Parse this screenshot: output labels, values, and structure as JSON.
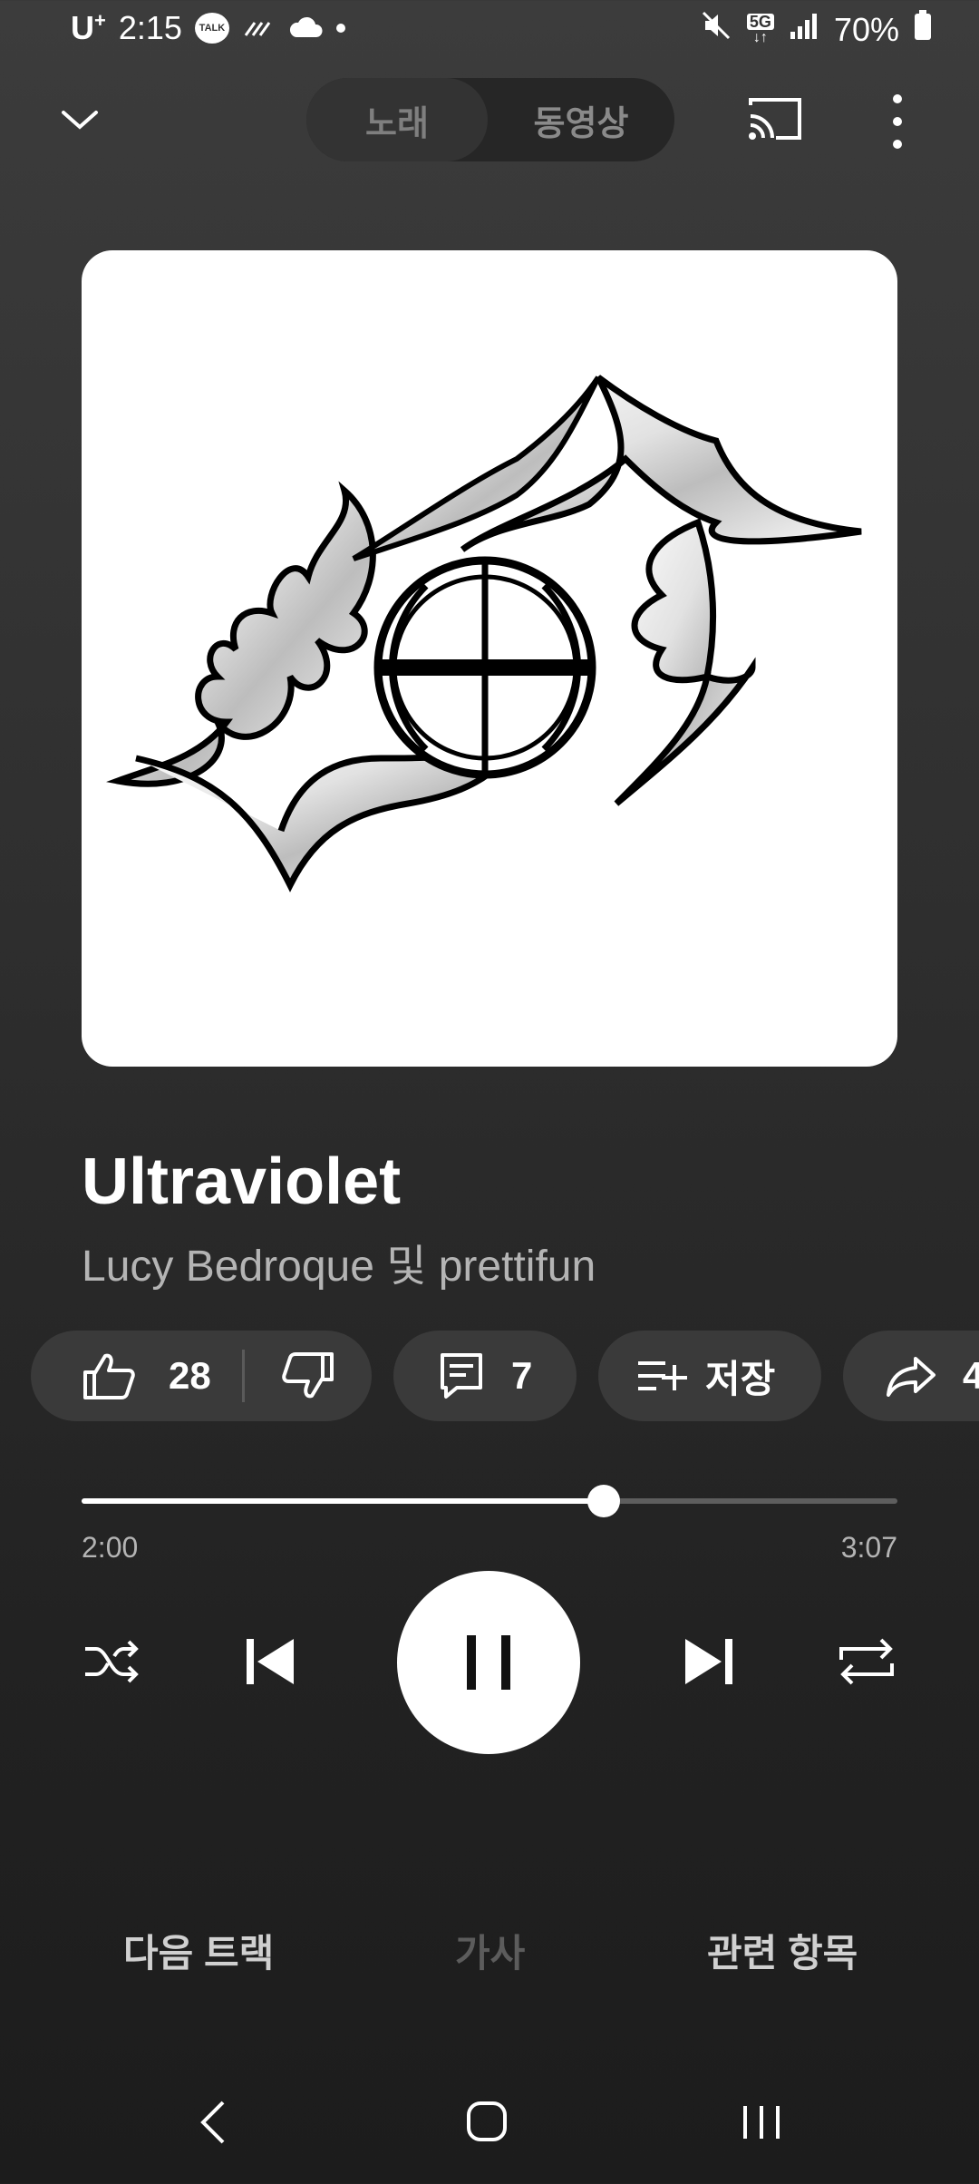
{
  "status_bar": {
    "carrier": "U",
    "carrier_sup": "+",
    "time": "2:15",
    "talk_badge": "TALK",
    "network": "5G",
    "battery": "70%",
    "icons": [
      "kakaotalk-icon",
      "wifi-call-icon",
      "cloud-icon",
      "dot-icon",
      "mute-icon",
      "network-5g-icon",
      "signal-icon",
      "battery-icon"
    ]
  },
  "top_bar": {
    "segment_song": "노래",
    "segment_video": "동영상",
    "selected_segment": "노래"
  },
  "track": {
    "title": "Ultraviolet",
    "artist": "Lucy Bedroque 및 prettifun"
  },
  "actions": {
    "likes": "28",
    "comments": "7",
    "save_label": "저장",
    "share_count": "4"
  },
  "progress": {
    "current": "2:00",
    "total": "3:07",
    "fraction": 0.64
  },
  "bottom_tabs": {
    "next": "다음 트랙",
    "lyrics": "가사",
    "related": "관련 항목"
  },
  "colors": {
    "accent": "#ffffff",
    "chip_bg": "#3a3a3a",
    "muted_text": "#b4b4b4",
    "disabled_tab": "#5c5c5c"
  }
}
